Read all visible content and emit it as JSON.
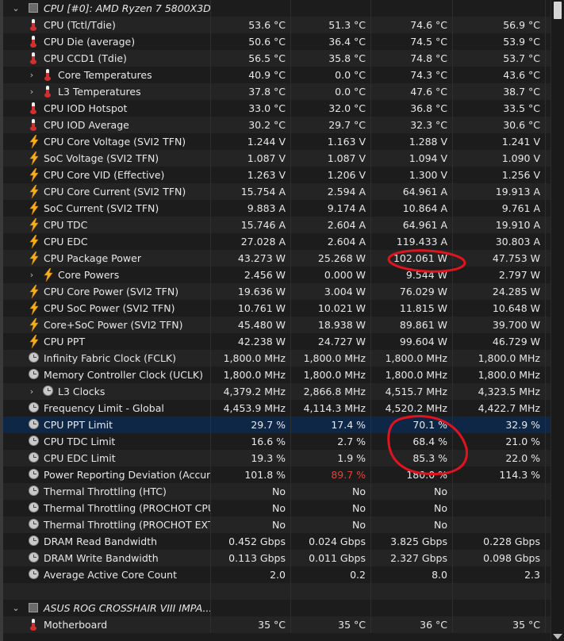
{
  "rows": [
    {
      "kind": "group",
      "exp": "⌄",
      "icon": "chip-icon",
      "label": "CPU [#0]: AMD Ryzen 7 5800X3D...",
      "v": [
        "",
        "",
        "",
        ""
      ]
    },
    {
      "icon": "thermometer-icon",
      "label": "CPU (Tctl/Tdie)",
      "v": [
        "53.6 °C",
        "51.3 °C",
        "74.6 °C",
        "56.9 °C"
      ]
    },
    {
      "icon": "thermometer-icon",
      "label": "CPU Die (average)",
      "v": [
        "50.6 °C",
        "36.4 °C",
        "74.5 °C",
        "53.9 °C"
      ]
    },
    {
      "icon": "thermometer-icon",
      "label": "CPU CCD1 (Tdie)",
      "v": [
        "56.5 °C",
        "35.8 °C",
        "74.8 °C",
        "53.7 °C"
      ]
    },
    {
      "exp": "›",
      "indent": 1,
      "icon": "thermometer-icon",
      "label": "Core Temperatures",
      "v": [
        "40.9 °C",
        "0.0 °C",
        "74.3 °C",
        "43.6 °C"
      ]
    },
    {
      "exp": "›",
      "indent": 1,
      "icon": "thermometer-icon",
      "label": "L3 Temperatures",
      "v": [
        "37.8 °C",
        "0.0 °C",
        "47.6 °C",
        "38.7 °C"
      ]
    },
    {
      "icon": "thermometer-icon",
      "label": "CPU IOD Hotspot",
      "v": [
        "33.0 °C",
        "32.0 °C",
        "36.8 °C",
        "33.5 °C"
      ]
    },
    {
      "icon": "thermometer-icon",
      "label": "CPU IOD Average",
      "v": [
        "30.2 °C",
        "29.7 °C",
        "32.3 °C",
        "30.6 °C"
      ]
    },
    {
      "icon": "lightning-icon",
      "label": "CPU Core Voltage (SVI2 TFN)",
      "v": [
        "1.244 V",
        "1.163 V",
        "1.288 V",
        "1.241 V"
      ]
    },
    {
      "icon": "lightning-icon",
      "label": "SoC Voltage (SVI2 TFN)",
      "v": [
        "1.087 V",
        "1.087 V",
        "1.094 V",
        "1.090 V"
      ]
    },
    {
      "icon": "lightning-icon",
      "label": "CPU Core VID (Effective)",
      "v": [
        "1.263 V",
        "1.206 V",
        "1.300 V",
        "1.256 V"
      ]
    },
    {
      "icon": "lightning-icon",
      "label": "CPU Core Current (SVI2 TFN)",
      "v": [
        "15.754 A",
        "2.594 A",
        "64.961 A",
        "19.913 A"
      ]
    },
    {
      "icon": "lightning-icon",
      "label": "SoC Current (SVI2 TFN)",
      "v": [
        "9.883 A",
        "9.174 A",
        "10.864 A",
        "9.761 A"
      ]
    },
    {
      "icon": "lightning-icon",
      "label": "CPU TDC",
      "v": [
        "15.746 A",
        "2.604 A",
        "64.961 A",
        "19.910 A"
      ]
    },
    {
      "icon": "lightning-icon",
      "label": "CPU EDC",
      "v": [
        "27.028 A",
        "2.604 A",
        "119.433 A",
        "30.803 A"
      ]
    },
    {
      "icon": "lightning-icon",
      "label": "CPU Package Power",
      "v": [
        "43.273 W",
        "25.268 W",
        "102.061 W",
        "47.753 W"
      ]
    },
    {
      "exp": "›",
      "indent": 1,
      "icon": "lightning-icon",
      "label": "Core Powers",
      "v": [
        "2.456 W",
        "0.000 W",
        "9.544 W",
        "2.797 W"
      ]
    },
    {
      "icon": "lightning-icon",
      "label": "CPU Core Power (SVI2 TFN)",
      "v": [
        "19.636 W",
        "3.004 W",
        "76.029 W",
        "24.285 W"
      ]
    },
    {
      "icon": "lightning-icon",
      "label": "CPU SoC Power (SVI2 TFN)",
      "v": [
        "10.761 W",
        "10.021 W",
        "11.815 W",
        "10.648 W"
      ]
    },
    {
      "icon": "lightning-icon",
      "label": "Core+SoC Power (SVI2 TFN)",
      "v": [
        "45.480 W",
        "18.938 W",
        "89.861 W",
        "39.700 W"
      ]
    },
    {
      "icon": "lightning-icon",
      "label": "CPU PPT",
      "v": [
        "42.238 W",
        "24.727 W",
        "99.604 W",
        "46.729 W"
      ]
    },
    {
      "icon": "clock-icon",
      "label": "Infinity Fabric Clock (FCLK)",
      "v": [
        "1,800.0 MHz",
        "1,800.0 MHz",
        "1,800.0 MHz",
        "1,800.0 MHz"
      ]
    },
    {
      "icon": "clock-icon",
      "label": "Memory Controller Clock (UCLK)",
      "v": [
        "1,800.0 MHz",
        "1,800.0 MHz",
        "1,800.0 MHz",
        "1,800.0 MHz"
      ]
    },
    {
      "exp": "›",
      "indent": 1,
      "icon": "clock-icon",
      "label": "L3 Clocks",
      "v": [
        "4,379.2 MHz",
        "2,866.8 MHz",
        "4,515.7 MHz",
        "4,323.5 MHz"
      ]
    },
    {
      "icon": "clock-icon",
      "label": "Frequency Limit - Global",
      "v": [
        "4,453.9 MHz",
        "4,114.3 MHz",
        "4,520.2 MHz",
        "4,422.7 MHz"
      ]
    },
    {
      "icon": "clock-icon",
      "label": "CPU PPT Limit",
      "highlight": true,
      "v": [
        "29.7 %",
        "17.4 %",
        "70.1 %",
        "32.9 %"
      ]
    },
    {
      "icon": "clock-icon",
      "label": "CPU TDC Limit",
      "v": [
        "16.6 %",
        "2.7 %",
        "68.4 %",
        "21.0 %"
      ]
    },
    {
      "icon": "clock-icon",
      "label": "CPU EDC Limit",
      "v": [
        "19.3 %",
        "1.9 %",
        "85.3 %",
        "22.0 %"
      ]
    },
    {
      "icon": "clock-icon",
      "label": "Power Reporting Deviation (Accur...",
      "v": [
        "101.8 %",
        "89.7 %",
        "180.0 %",
        "114.3 %"
      ],
      "red": [
        1
      ]
    },
    {
      "icon": "clock-icon",
      "label": "Thermal Throttling (HTC)",
      "v": [
        "No",
        "No",
        "No",
        ""
      ]
    },
    {
      "icon": "clock-icon",
      "label": "Thermal Throttling (PROCHOT CPU)",
      "v": [
        "No",
        "No",
        "No",
        ""
      ]
    },
    {
      "icon": "clock-icon",
      "label": "Thermal Throttling (PROCHOT EXT)",
      "v": [
        "No",
        "No",
        "No",
        ""
      ]
    },
    {
      "icon": "clock-icon",
      "label": "DRAM Read Bandwidth",
      "v": [
        "0.452 Gbps",
        "0.024 Gbps",
        "3.825 Gbps",
        "0.228 Gbps"
      ]
    },
    {
      "icon": "clock-icon",
      "label": "DRAM Write Bandwidth",
      "v": [
        "0.113 Gbps",
        "0.011 Gbps",
        "2.327 Gbps",
        "0.098 Gbps"
      ]
    },
    {
      "icon": "clock-icon",
      "label": "Average Active Core Count",
      "v": [
        "2.0",
        "0.2",
        "8.0",
        "2.3"
      ]
    },
    {
      "kind": "blank",
      "label": "",
      "v": [
        "",
        "",
        "",
        ""
      ]
    },
    {
      "kind": "group",
      "exp": "⌄",
      "icon": "chip-icon",
      "label": "ASUS ROG CROSSHAIR VIII IMPA...",
      "v": [
        "",
        "",
        "",
        ""
      ]
    },
    {
      "icon": "thermometer-icon",
      "label": "Motherboard",
      "v": [
        "35 °C",
        "35 °C",
        "36 °C",
        "35 °C"
      ]
    }
  ],
  "colors": {
    "background": "#1c1c1c",
    "highlight_row": "#0e2746",
    "annotation": "#e0141e",
    "warning_text": "#e0443a"
  }
}
